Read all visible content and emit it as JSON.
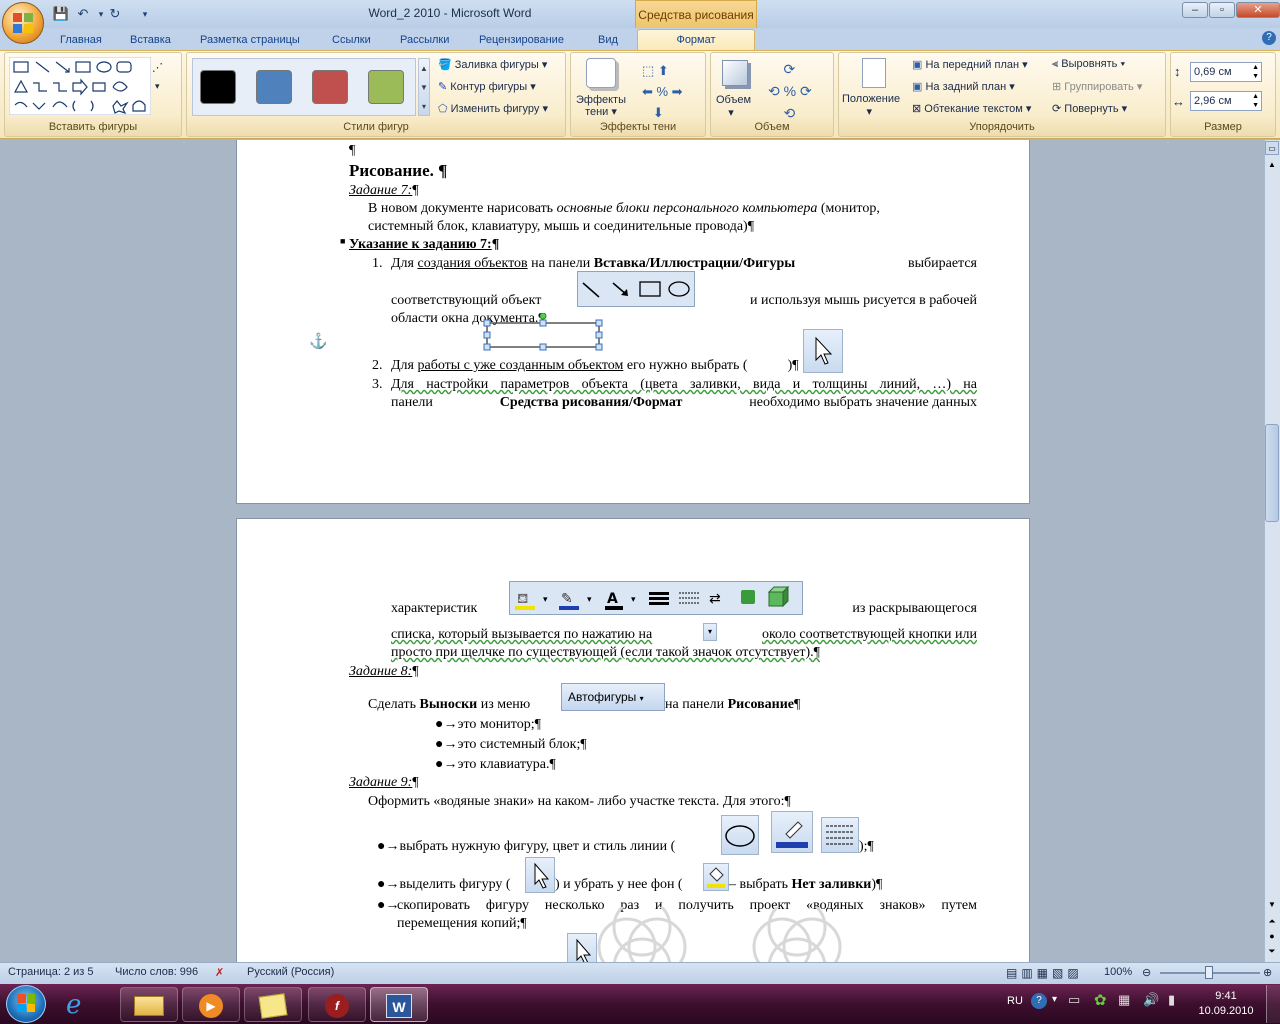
{
  "window": {
    "title": "Word_2 2010  -  Microsoft Word",
    "context_title": "Средства рисования"
  },
  "tabs": [
    "Главная",
    "Вставка",
    "Разметка страницы",
    "Ссылки",
    "Рассылки",
    "Рецензирование",
    "Вид",
    "Формат"
  ],
  "ribbon": {
    "insert_shapes": {
      "label": "Вставить фигуры"
    },
    "shape_styles": {
      "label": "Стили фигур",
      "swatch_colors": [
        "#000000",
        "#4f81bd",
        "#c0504d",
        "#9bbb59"
      ],
      "fill": "Заливка фигуры",
      "outline": "Контур фигуры",
      "change": "Изменить фигуру"
    },
    "shadow": {
      "button": "Эффекты тени",
      "label": "Эффекты тени"
    },
    "volume": {
      "button": "Объем",
      "label": "Объем"
    },
    "arrange": {
      "label": "Упорядочить",
      "position": "Положение",
      "front": "На передний план",
      "back": "На задний план",
      "wrap": "Обтекание текстом",
      "align": "Выровнять",
      "group": "Группировать",
      "rotate": "Повернуть"
    },
    "size": {
      "label": "Размер",
      "height": "0,69 см",
      "width": "2,96 см"
    }
  },
  "doc": {
    "p1": {
      "pilcrow_top": "¶",
      "heading": "Рисование. ¶",
      "task7": "Задание 7:",
      "task7_pil": "¶",
      "t7_line1a": "В новом документе нарисовать ",
      "t7_line1b": "основные блоки персонального компьютера",
      "t7_line1c": " (монитор,",
      "t7_line2": "системный блок, клавиатуру, мышь и соединительные провода)¶",
      "hint": "Указание к заданию 7:",
      "hint_pil": "¶",
      "li1_num": "1.",
      "li1_a": "Для ",
      "li1_b": "создания объектов",
      "li1_c": " на панели ",
      "li1_d": "Вставка/Иллюстрации/Фигуры",
      "li1_e": " выбирается",
      "li1_line2a": "соответствующий объект",
      "li1_line2b": "и используя мышь рисуется в рабочей",
      "li1_line3": "области окна документа.¶",
      "li2_num": "2.",
      "li2_a": "Для ",
      "li2_b": "работы с уже созданным объектом",
      "li2_c": " его нужно выбрать (",
      "li2_d": ")¶",
      "li3_num": "3.",
      "li3_a": "Для настройки параметров объекта (цвета заливки, вида и толщины линий, …) на",
      "li3_b1": "панели ",
      "li3_b2": "Средства рисования/Формат",
      "li3_b3": " необходимо выбрать значение данных"
    },
    "p2": {
      "c1a": "характеристик",
      "c1b": "из раскрывающегося",
      "c2": "списка, который вызывается по нажатию на",
      "c2b": "около соответствующей кнопки или",
      "c3": "просто при щелчке по существующей (если такой значок отсутствует).¶",
      "task8": "Задание 8:",
      "task8_pil": "¶",
      "t8_a": "Сделать ",
      "t8_b": "Выноски",
      "t8_c": " из меню",
      "autoshapes": "Автофигуры",
      "t8_d": "на панели ",
      "t8_e": "Рисование",
      "t8_f": "¶",
      "b1": "это монитор;¶",
      "b2": "это системный блок;¶",
      "b3": "это клавиатура.¶",
      "task9": "Задание 9:",
      "task9_pil": "¶",
      "t9": "Оформить «водяные знаки» на каком- либо участке текста. Для этого:¶",
      "s1a": "выбрать нужную фигуру, цвет и стиль линии (",
      "s1b": ");¶",
      "s2a": "выделить фигуру (",
      "s2b": ") и убрать у нее фон (",
      "s2c": "– выбрать ",
      "s2d": "Нет заливки",
      "s2e": ")¶",
      "s3a": "скопировать фигуру несколько раз и получить проект «водяных знаков» путем",
      "s3b": "перемещения копий;¶"
    }
  },
  "status": {
    "page": "Страница: 2 из 5",
    "words": "Число слов: 996",
    "lang": "Русский (Россия)",
    "zoom": "100%"
  },
  "taskbar": {
    "lang": "RU",
    "time": "9:41",
    "date": "10.09.2010"
  }
}
